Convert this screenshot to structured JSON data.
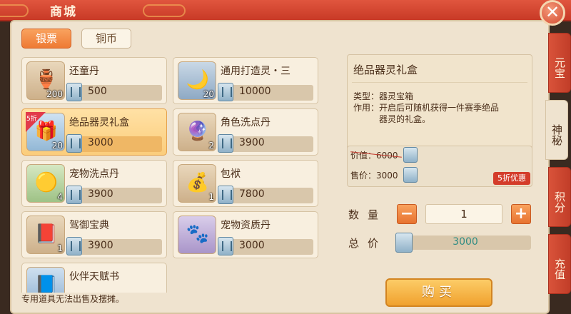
{
  "header": {
    "title": "商城"
  },
  "currency_tabs": [
    {
      "label": "银票",
      "active": true
    },
    {
      "label": "铜币",
      "active": false
    }
  ],
  "items": [
    {
      "name": "还童丹",
      "count": "200",
      "price": "500",
      "icon": "vase-icon",
      "glyph": "🏺"
    },
    {
      "name": "通用打造灵・三",
      "count": "20",
      "price": "10000",
      "icon": "moon-spirit-icon",
      "glyph": "🌙"
    },
    {
      "name": "绝品器灵礼盒",
      "count": "20",
      "price": "3000",
      "icon": "gift-box-icon",
      "glyph": "🎁",
      "discount": "5折",
      "selected": true
    },
    {
      "name": "角色洗点丹",
      "count": "2",
      "price": "3900",
      "icon": "purple-orb-icon",
      "glyph": "🔮"
    },
    {
      "name": "宠物洗点丹",
      "count": "4",
      "price": "3900",
      "icon": "yellow-orb-icon",
      "glyph": "🟡"
    },
    {
      "name": "包袱",
      "count": "1",
      "price": "7800",
      "icon": "bundle-bag-icon",
      "glyph": "💰"
    },
    {
      "name": "驾御宝典",
      "count": "1",
      "price": "3900",
      "icon": "book-icon",
      "glyph": "📕"
    },
    {
      "name": "宠物资质丹",
      "count": "",
      "price": "3000",
      "icon": "paw-orb-icon",
      "glyph": "🐾"
    },
    {
      "name": "伙伴天赋书",
      "count": "",
      "price": "",
      "icon": "talent-book-icon",
      "glyph": "📘"
    }
  ],
  "footnote": "专用道具无法出售及摆摊。",
  "detail": {
    "name": "绝品器灵礼盒",
    "type_line": "类型：器灵宝箱",
    "use_line1": "作用：开启后可随机获得一件赛季绝品",
    "use_line2": "器灵的礼盒。",
    "original_price": "价值：6000",
    "sale_price": "售价：3000",
    "sale_tag": "5折优惠"
  },
  "purchase": {
    "qty_label": "数量",
    "qty_value": "1",
    "minus": "−",
    "plus": "+",
    "total_label": "总价",
    "total_value": "3000",
    "buy_label": "购买"
  },
  "side_tabs": [
    {
      "label": "元宝",
      "active": false
    },
    {
      "label": "神秘",
      "active": true
    },
    {
      "label": "积分",
      "active": false
    },
    {
      "label": "充值",
      "active": false
    }
  ],
  "colors": {
    "accent": "#ee7a34",
    "banner": "#c83a26",
    "panel": "#efe3cf",
    "total_text": "#2f8c83"
  }
}
